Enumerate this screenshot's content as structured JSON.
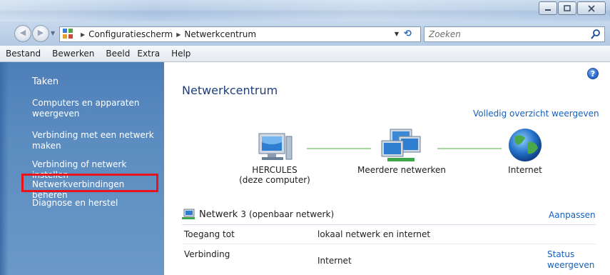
{
  "window": {
    "buttons": [
      "minimize",
      "maximize",
      "close"
    ]
  },
  "address": {
    "breadcrumbs": [
      "Configuratiescherm",
      "Netwerkcentrum"
    ],
    "search_placeholder": "Zoeken"
  },
  "menu": {
    "items": [
      "Bestand",
      "Bewerken",
      "Beeld",
      "Extra",
      "Help"
    ]
  },
  "sidebar": {
    "heading": "Taken",
    "items": [
      {
        "label": "Computers en apparaten weergeven"
      },
      {
        "label": "Verbinding met een netwerk maken"
      },
      {
        "label": "Verbinding of netwerk instellen"
      },
      {
        "label": "Netwerkverbindingen beheren",
        "highlighted": true
      },
      {
        "label": "Diagnose en herstel"
      }
    ]
  },
  "main": {
    "title": "Netwerkcentrum",
    "full_map_link": "Volledig overzicht weergeven",
    "nodes": [
      {
        "name": "HERCULES",
        "sub": "(deze computer)",
        "icon": "computer-icon"
      },
      {
        "name": "Meerdere netwerken",
        "sub": "",
        "icon": "networks-icon"
      },
      {
        "name": "Internet",
        "sub": "",
        "icon": "globe-icon"
      }
    ],
    "network": {
      "name": "Netwerk",
      "number": "3",
      "type": "(openbaar netwerk)",
      "customize": "Aanpassen"
    },
    "rows": [
      {
        "label": "Toegang tot",
        "value": "lokaal netwerk en internet"
      },
      {
        "label": "Verbinding",
        "value": "Internet",
        "action": "Status weergeven"
      }
    ]
  },
  "colors": {
    "sidebar": "#5a8bc0",
    "link": "#1560bd",
    "highlight_border": "#e8131b",
    "title": "#1e3f7a"
  }
}
